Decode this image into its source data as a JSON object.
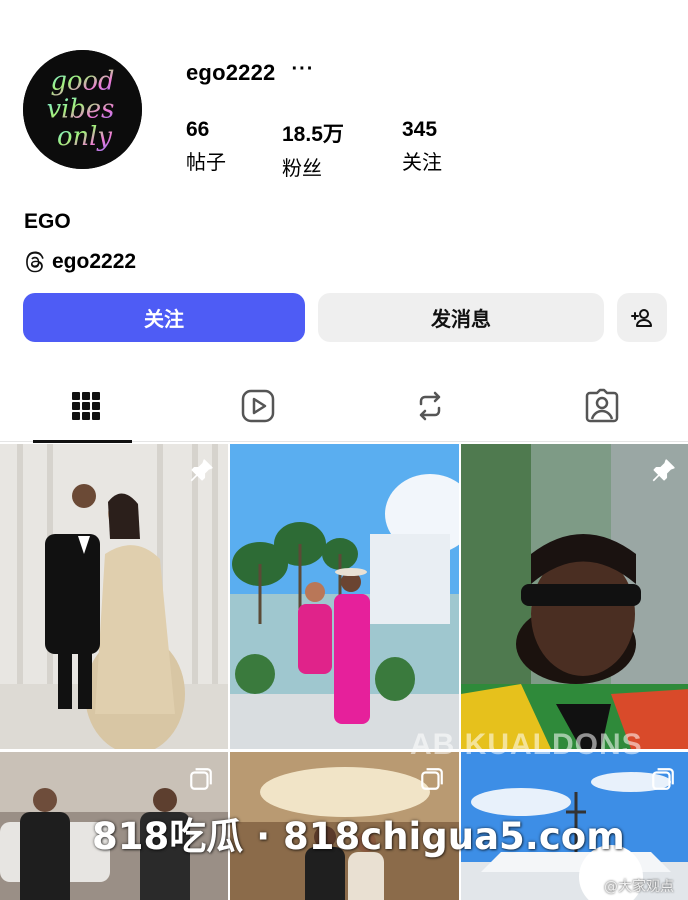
{
  "profile": {
    "username": "ego2222",
    "more_label": "···",
    "display_name": "EGO",
    "threads_handle": "ego2222",
    "avatar_text": "good vibes only"
  },
  "stats": {
    "posts": {
      "value": "66",
      "label": "帖子"
    },
    "followers": {
      "value": "18.5万",
      "label": "粉丝"
    },
    "following": {
      "value": "345",
      "label": "关注"
    }
  },
  "actions": {
    "follow_label": "关注",
    "message_label": "发消息",
    "add_user_icon": "person-add-icon"
  },
  "tabs": [
    {
      "name": "grid-icon",
      "active": true
    },
    {
      "name": "reels-icon",
      "active": false
    },
    {
      "name": "reposts-icon",
      "active": false
    },
    {
      "name": "tagged-icon",
      "active": false
    }
  ],
  "posts": [
    {
      "scene": "couple in black tuxedo and gold gown, white curtain",
      "badge": "pin-icon"
    },
    {
      "scene": "couple in pink outfits by pool with palm trees",
      "badge": ""
    },
    {
      "scene": "man with beard and sunglasses, green pattern shirt",
      "badge": "pin-icon"
    },
    {
      "scene": "group of men by luxury cars",
      "badge": "carousel-icon"
    },
    {
      "scene": "couple in elegant interior",
      "badge": "carousel-icon"
    },
    {
      "scene": "yacht under blue sky",
      "badge": "carousel-icon"
    }
  ],
  "overlays": {
    "watermark": "818吃瓜 · 818chigua5.com",
    "watermark_faint": "AB KUALDONS",
    "weibo_credit": "@大家观点"
  },
  "colors": {
    "accent": "#4e5cf5",
    "button_gray": "#efefef"
  }
}
